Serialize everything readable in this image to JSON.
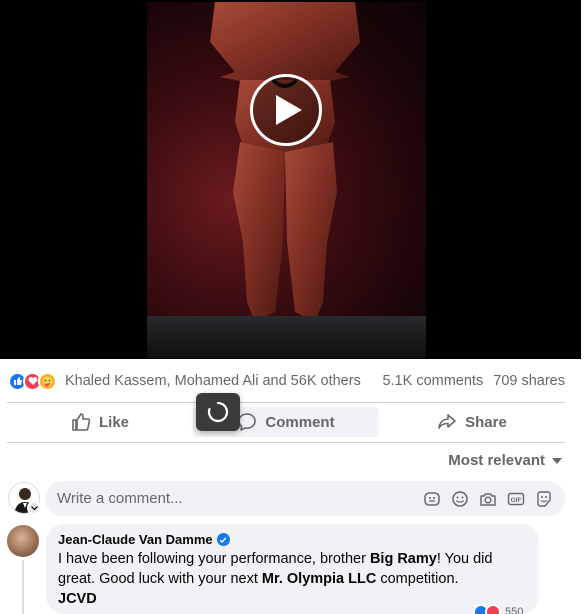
{
  "post": {
    "reaction_names": "Khaled Kassem, Mohamed Ali and 56K others",
    "comments_count": "5.1K comments",
    "shares_count": "709 shares",
    "reactions": [
      "like-icon",
      "love-icon",
      "care-icon"
    ]
  },
  "actions": {
    "like_label": "Like",
    "comment_label": "Comment",
    "share_label": "Share"
  },
  "sort": {
    "label": "Most relevant"
  },
  "composer": {
    "placeholder": "Write a comment..."
  },
  "comment": {
    "author": "Jean-Claude Van Damme",
    "text_1": "I have been following your performance, brother ",
    "mention_1": "Big Ramy",
    "text_2": "! You did great. Good luck with your next ",
    "mention_2": "Mr. Olympia LLC",
    "text_3": " competition.",
    "signature": "JCVD",
    "reaction_count": "550"
  },
  "colors": {
    "accent": "#1877f2",
    "muted": "#65676b",
    "surface": "#f0f2f5"
  }
}
